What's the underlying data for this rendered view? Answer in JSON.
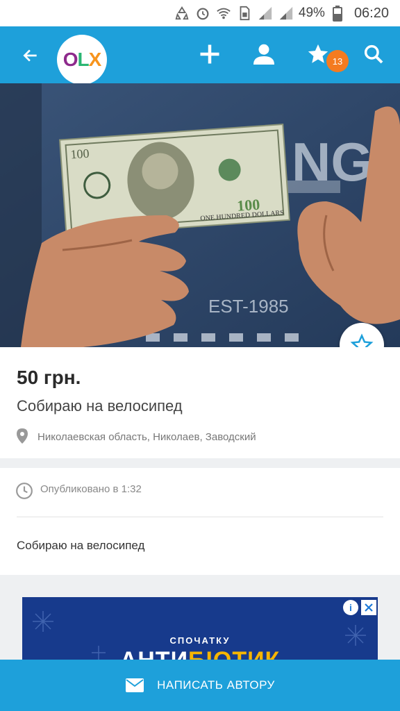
{
  "status_bar": {
    "battery": "49%",
    "time": "06:20",
    "icons": [
      "recycle-icon",
      "alarm-icon",
      "wifi-icon",
      "sim-icon",
      "signal-icon",
      "signal-icon",
      "battery-icon"
    ]
  },
  "app_bar": {
    "logo": {
      "o": "O",
      "l": "L",
      "x": "X"
    },
    "favorites_count": "13",
    "icons": [
      "back-arrow-icon",
      "plus-icon",
      "user-icon",
      "star-icon",
      "search-icon"
    ],
    "color": "#1ea0da"
  },
  "listing": {
    "price": "50 грн.",
    "title": "Собираю на велосипед",
    "location": "Николаевская область, Николаев, Заводский",
    "published": "Опубликовано в 1:32",
    "description": "Собираю на велосипед"
  },
  "ad": {
    "pre_title": "СПОЧАТКУ",
    "main_white": "АНТИ",
    "main_yellow": "БІОТИК"
  },
  "cta": {
    "label": "НАПИСАТЬ АВТОРУ",
    "icon": "envelope-icon"
  }
}
